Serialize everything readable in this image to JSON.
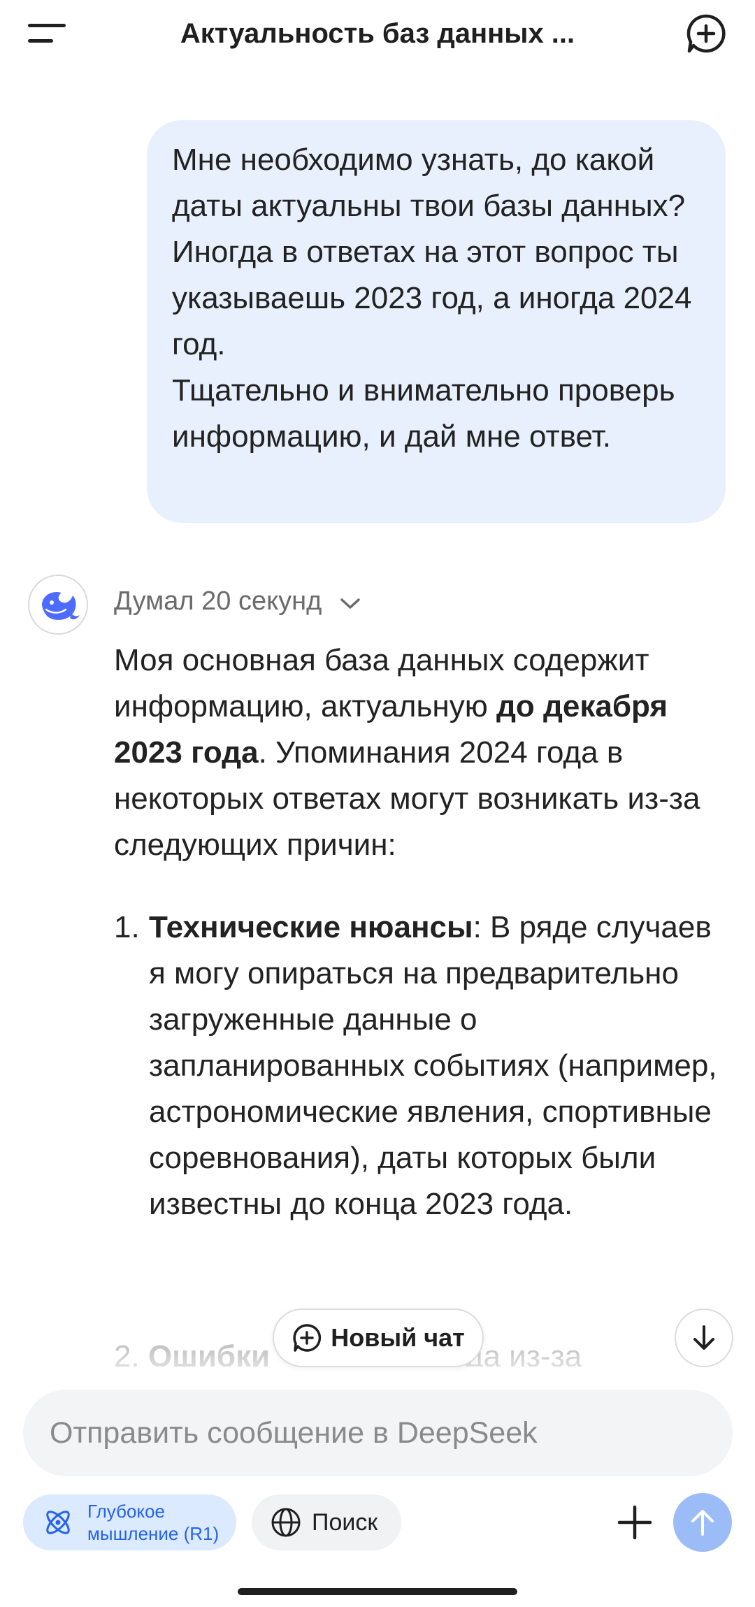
{
  "header": {
    "title": "Актуальность баз данных ...",
    "menu_icon": "menu-icon",
    "new_chat_icon": "new-chat-plus-icon"
  },
  "user_message": {
    "paragraph1": "Мне необходимо узнать, до какой даты актуальны твои базы данных? Иногда в ответах на этот вопрос ты указываешь 2023 год, а иногда 2024 год.",
    "paragraph2": "Тщательно и внимательно проверь информацию, и дай мне ответ."
  },
  "assistant": {
    "avatar_icon": "deepseek-whale-icon",
    "thought_label": "Думал 20 секунд",
    "intro_part1": "Моя основная база данных содержит информацию, актуальную ",
    "intro_bold": "до декабря 2023 года",
    "intro_part2": ". Упоминания 2024 года в некоторых ответах могут возникать из-за следующих причин:",
    "items": [
      {
        "num": "1.",
        "bold": "Технические нюансы",
        "text": ": В ряде случаев я могу опираться на предварительно загруженные данные о запланированных событиях (например, астрономические явления, спортивные соревнования), даты которых были известны до конца 2023 года."
      },
      {
        "num": "2.",
        "bold": "Ошибки",
        "text": "иногда из-за"
      }
    ]
  },
  "floating": {
    "new_chat_label": "Новый чат"
  },
  "composer": {
    "placeholder": "Отправить сообщение в DeepSeek",
    "value": "",
    "deep_thinking_label": "Глубокое\nмышление (R1)",
    "search_label": "Поиск"
  },
  "colors": {
    "accent": "#2563eb",
    "user_bubble": "#e8f0fd",
    "send_button": "#9bbcf7",
    "deep_thinking_bg": "#dbeafe"
  }
}
